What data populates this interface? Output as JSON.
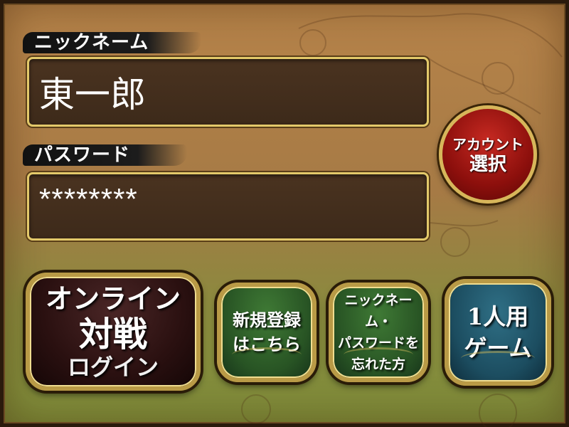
{
  "nickname": {
    "label": "ニックネーム",
    "value": "東一郎"
  },
  "password": {
    "label": "パスワード",
    "value": "********"
  },
  "account_button": {
    "line1": "アカウント",
    "line2": "選択"
  },
  "online_button": {
    "line1": "オンライン",
    "line2": "対戦",
    "line3": "ログイン"
  },
  "register_button": {
    "line1": "新規登録",
    "line2": "はこちら"
  },
  "forgot_button": {
    "line1": "ニックネーム・",
    "line2": "パスワードを",
    "line3": "忘れた方"
  },
  "single_button": {
    "line1": "1人用",
    "line2": "ゲーム"
  },
  "colors": {
    "field_border": "#e3c96a",
    "account_red": "#c72a22",
    "online_dark": "#2a1010",
    "register_green": "#285424",
    "single_teal": "#1c4d60"
  }
}
